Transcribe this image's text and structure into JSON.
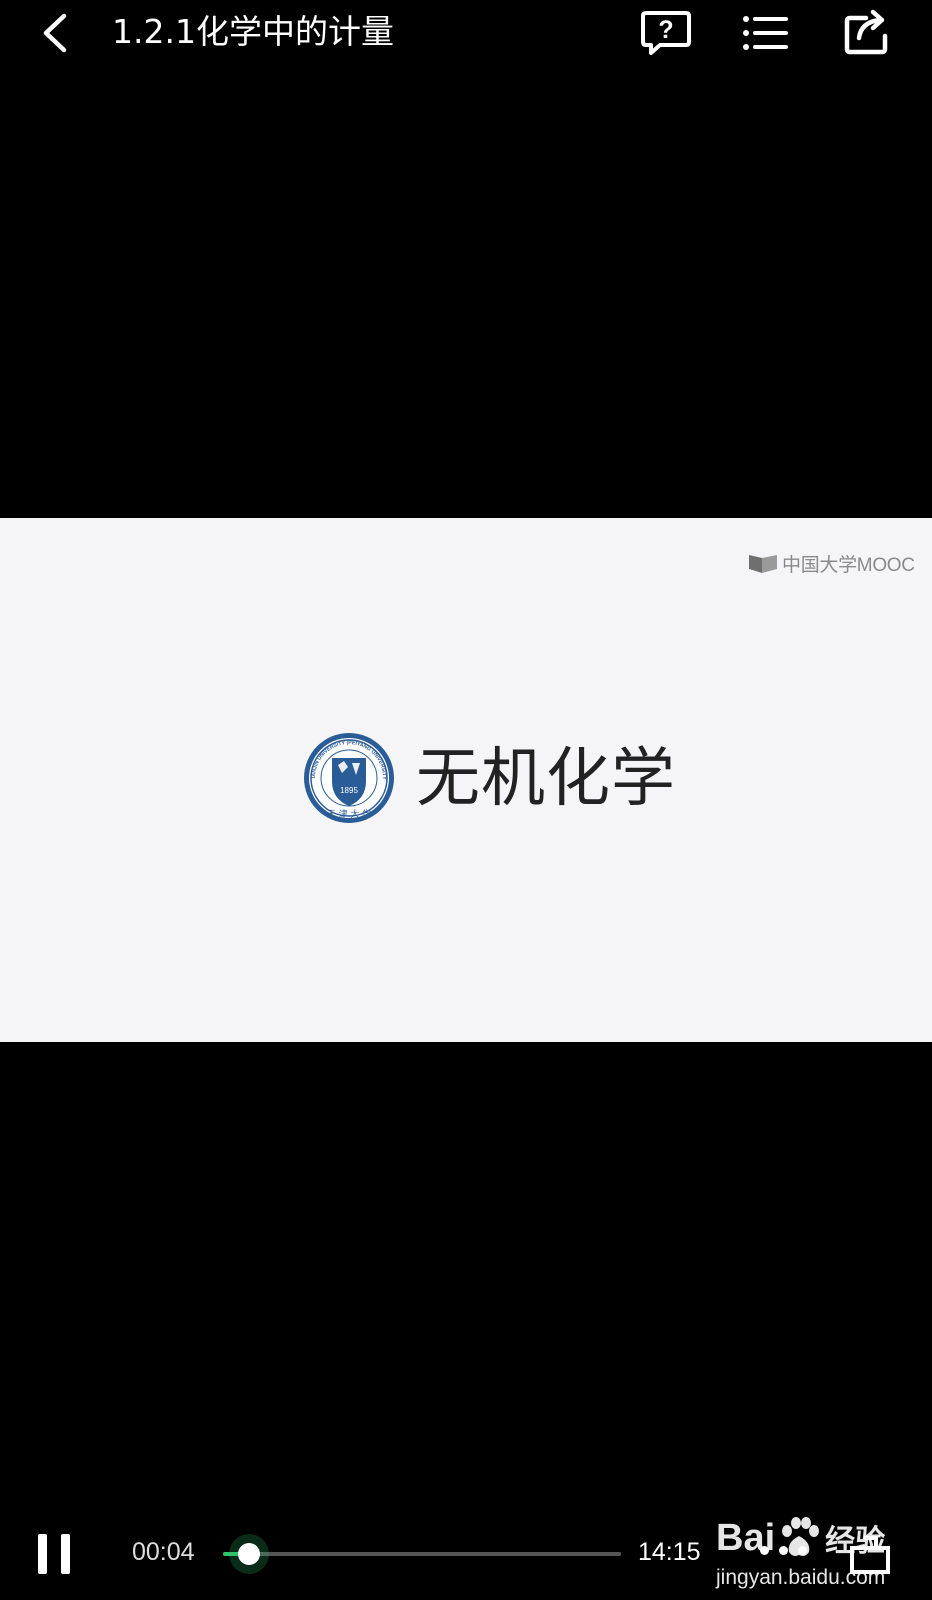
{
  "header": {
    "title": "1.2.1化学中的计量"
  },
  "video_slide": {
    "watermark_brand": "中国大学MOOC",
    "course_title": "无机化学",
    "seal_year": "1895",
    "seal_university": "TIANJIN UNIVERSITY (PEIYANG UNIVERSITY)"
  },
  "player": {
    "current_time": "00:04",
    "total_time": "14:15",
    "progress_fraction": 0.0047,
    "accent_color": "#2ec26a"
  },
  "source_watermark": {
    "logo_prefix": "Bai",
    "logo_suffix": "经验",
    "url": "jingyan.baidu.com"
  },
  "icons": [
    "back-icon",
    "help-question-icon",
    "playlist-icon",
    "share-icon",
    "pause-icon",
    "more-icon",
    "fullscreen-icon"
  ]
}
